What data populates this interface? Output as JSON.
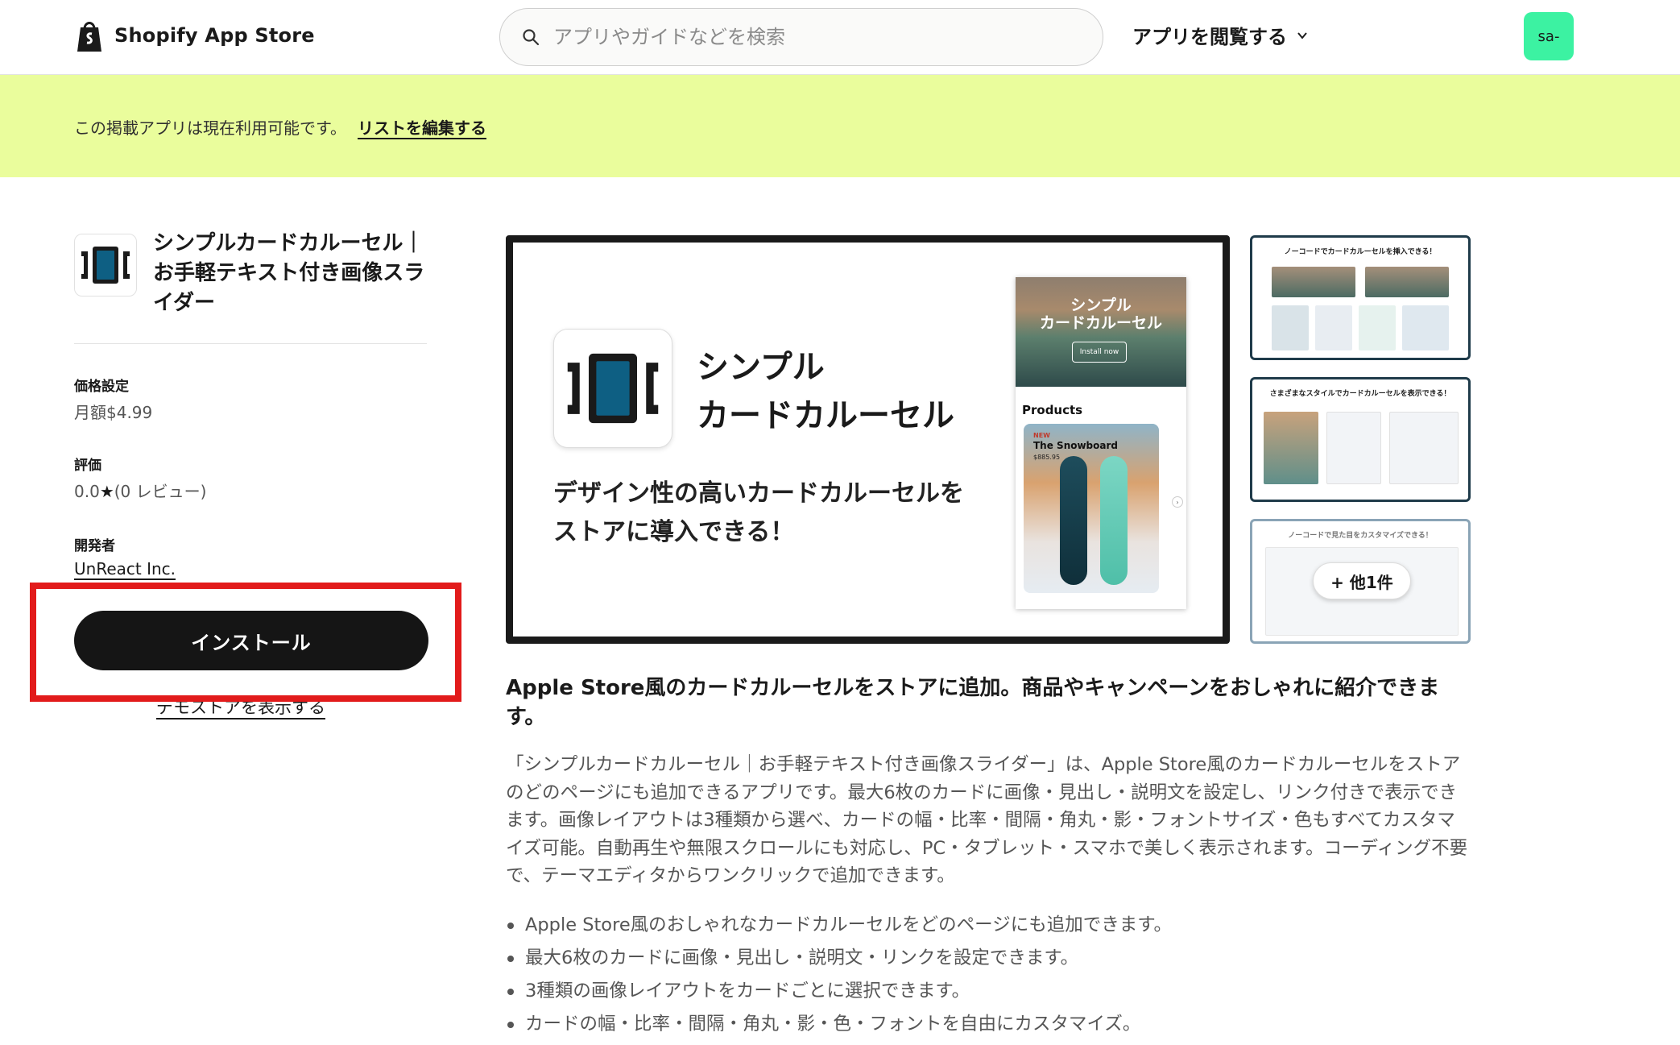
{
  "header": {
    "logo_text": "Shopify App Store",
    "search_placeholder": "アプリやガイドなどを検索",
    "browse_label": "アプリを閲覧する",
    "avatar_text": "sa-"
  },
  "banner": {
    "text": "この掲載アプリは現在利用可能です。",
    "link": "リストを編集する"
  },
  "app": {
    "title": "シンプルカードカルーセル｜お手軽テキスト付き画像スライダー",
    "pricing_label": "価格設定",
    "pricing_value": "月額$4.99",
    "rating_label": "評価",
    "rating_value": "0.0",
    "rating_reviews": "(0 レビュー)",
    "developer_label": "開発者",
    "developer_name": "UnReact Inc.",
    "install_label": "インストール",
    "demo_label": "デモストアを表示する"
  },
  "hero": {
    "title_line1": "シンプル",
    "title_line2": "カードカルーセル",
    "sub_line1": "デザイン性の高いカードカルーセルを",
    "sub_line2": "ストアに導入できる！",
    "mock_title_line1": "シンプル",
    "mock_title_line2": "カードカルーセル",
    "mock_install": "Install now",
    "mock_products": "Products",
    "mock_card_new": "NEW",
    "mock_card_name": "The Snowboard",
    "mock_card_price": "$885.95"
  },
  "thumbs": [
    {
      "caption": "ノーコードでカードカルーセルを挿入できる！"
    },
    {
      "caption": "さまざまなスタイルでカードカルーセルを表示できる！"
    },
    {
      "caption": "ノーコードで見た目をカスタマイズできる！"
    }
  ],
  "more_label": "+ 他1件",
  "description": {
    "headline": "Apple Store風のカードカルーセルをストアに追加。商品やキャンペーンをおしゃれに紹介できます。",
    "body": "「シンプルカードカルーセル｜お手軽テキスト付き画像スライダー」は、Apple Store風のカードカルーセルをストアのどのページにも追加できるアプリです。最大6枚のカードに画像・見出し・説明文を設定し、リンク付きで表示できます。画像レイアウトは3種類から選べ、カードの幅・比率・間隔・角丸・影・フォントサイズ・色もすべてカスタマイズ可能。自動再生や無限スクロールにも対応し、PC・タブレット・スマホで美しく表示されます。コーディング不要で、テーマエディタからワンクリックで追加できます。",
    "bullets": [
      "Apple Store風のおしゃれなカードカルーセルをどのページにも追加できます。",
      "最大6枚のカードに画像・見出し・説明文・リンクを設定できます。",
      "3種類の画像レイアウトをカードごとに選択できます。",
      "カードの幅・比率・間隔・角丸・影・色・フォントを自由にカスタマイズ。"
    ]
  },
  "colors": {
    "banner_bg": "#eafd9c",
    "avatar_bg": "#3cf2a2",
    "install_bg": "#151515",
    "highlight_border": "#e21b1b",
    "brand_accent": "#0e5f83"
  }
}
